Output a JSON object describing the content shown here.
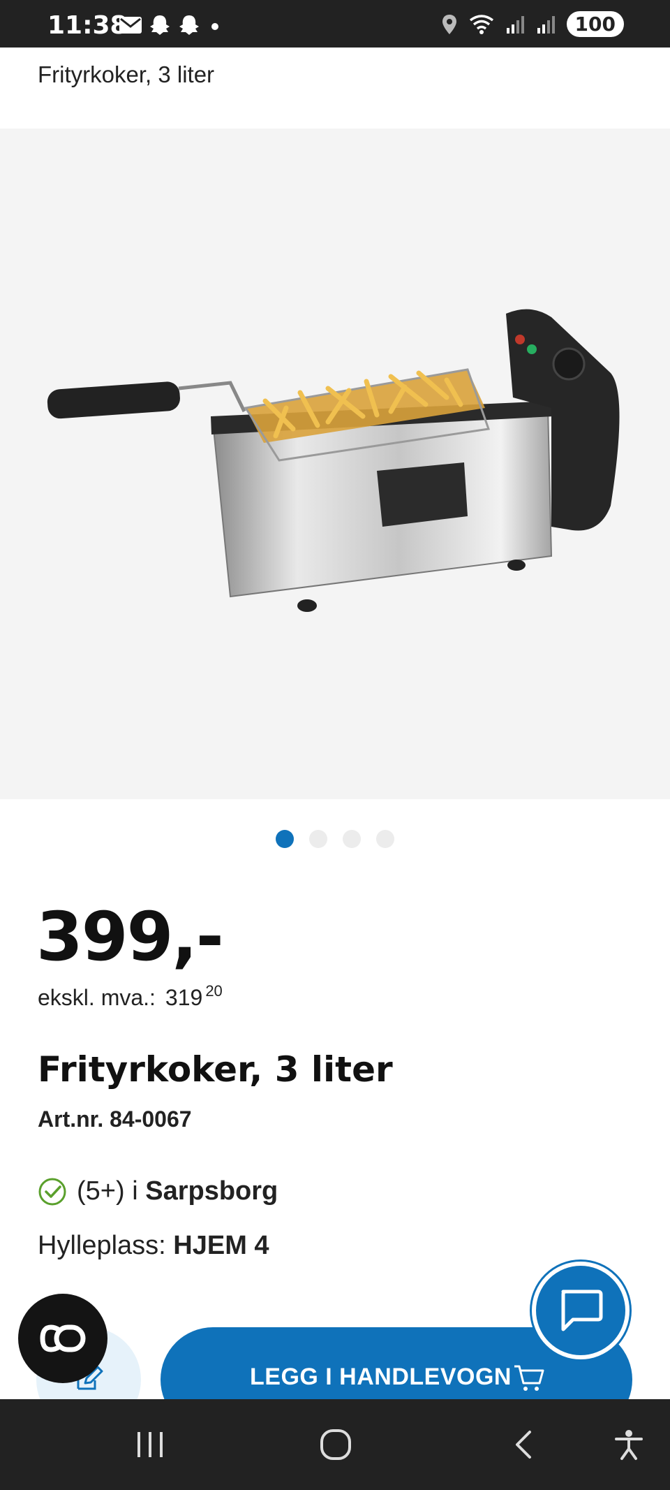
{
  "status_bar": {
    "time": "11:38",
    "battery": "100",
    "left_icons": [
      "mail-icon",
      "snapchat-icon",
      "snapchat-icon",
      "dot-icon"
    ],
    "right_icons": [
      "location-icon",
      "wifi-icon",
      "signal-icon",
      "signal-icon"
    ]
  },
  "header": {
    "title": "Frityrkoker, 3 liter"
  },
  "gallery": {
    "image_count": 4,
    "active_index": 0
  },
  "product": {
    "price": "399,-",
    "vat_label": "ekskl. mva.:",
    "vat_kroner": "319",
    "vat_ore": "20",
    "name": "Frityrkoker, 3 liter",
    "article_number": "Art.nr. 84-0067",
    "stock_count": "(5+)",
    "stock_in": "i",
    "stock_store": "Sarpsborg",
    "shelf_label": "Hylleplass:",
    "shelf_value": "HJEM 4"
  },
  "actions": {
    "add_to_cart_label": "LEGG I HANDLEVOGN"
  },
  "colors": {
    "brand_blue": "#0f72ba",
    "stock_green": "#5aa02c",
    "dark": "#141414"
  }
}
